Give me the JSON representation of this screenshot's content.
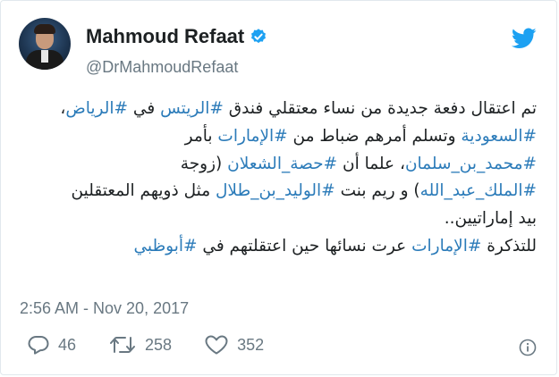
{
  "author": {
    "name": "Mahmoud Refaat",
    "handle": "@DrMahmoudRefaat",
    "verified": true
  },
  "tweet": {
    "lines": [
      [
        {
          "t": "تم اعتقال دفعة جديدة من نساء معتقلي فندق "
        },
        {
          "t": "#الريتس",
          "tag": true
        },
        {
          "t": " في "
        },
        {
          "t": "#الرياض",
          "tag": true
        },
        {
          "t": "،"
        }
      ],
      [
        {
          "t": "#السعودية",
          "tag": true
        },
        {
          "t": " وتسلم أمرهم ضباط من "
        },
        {
          "t": "#الإمارات",
          "tag": true
        },
        {
          "t": " بأمر"
        }
      ],
      [
        {
          "t": "#محمد_بن_سلمان",
          "tag": true
        },
        {
          "t": "، علما أن "
        },
        {
          "t": "#حصة_الشعلان",
          "tag": true
        },
        {
          "t": " (زوجة"
        }
      ],
      [
        {
          "t": "#الملك_عبد_الله",
          "tag": true
        },
        {
          "t": ") و ريم بنت "
        },
        {
          "t": "#الوليد_بن_طلال",
          "tag": true
        },
        {
          "t": " مثل ذويهم المعتقلين"
        }
      ],
      [
        {
          "t": "بيد إماراتيين.."
        }
      ],
      [
        {
          "t": "للتذكرة "
        },
        {
          "t": "#الإمارات",
          "tag": true
        },
        {
          "t": " عرت نسائها حين اعتقلتهم في "
        },
        {
          "t": "#أبوظبي",
          "tag": true
        }
      ]
    ],
    "timestamp": "2:56 AM - Nov 20, 2017"
  },
  "actions": {
    "replies": "46",
    "retweets": "258",
    "likes": "352"
  },
  "icons": {
    "verified": "verified-badge-icon",
    "brand": "twitter-bird-icon",
    "reply": "reply-icon",
    "retweet": "retweet-icon",
    "like": "heart-icon",
    "info": "info-icon"
  },
  "colors": {
    "accent": "#1da1f2",
    "hashtag": "#2b7bb9",
    "text": "#1c2022",
    "muted": "#697882",
    "border": "#e1e8ed"
  }
}
